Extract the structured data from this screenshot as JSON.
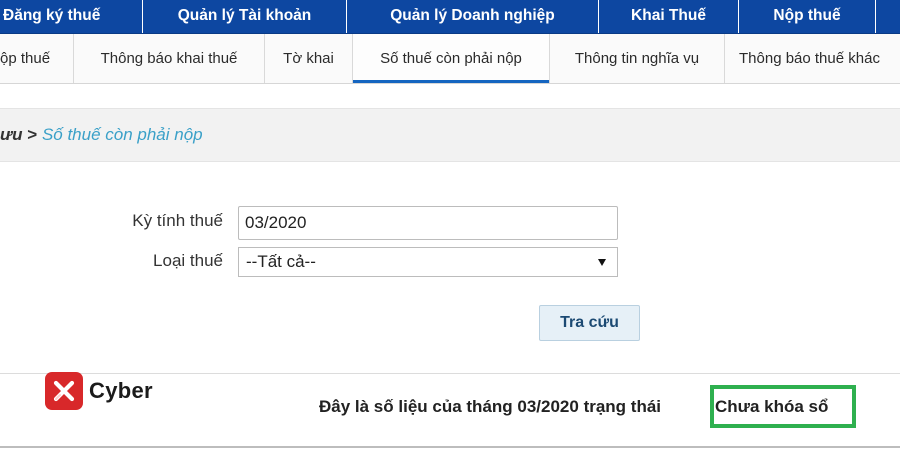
{
  "top_nav": {
    "items": [
      {
        "label": "Đăng ký thuế"
      },
      {
        "label": "Quản lý Tài khoản"
      },
      {
        "label": "Quản lý Doanh nghiệp"
      },
      {
        "label": "Khai Thuế"
      },
      {
        "label": "Nộp thuế"
      },
      {
        "label": ""
      }
    ]
  },
  "sub_nav": {
    "items": [
      {
        "label": "ộp thuế"
      },
      {
        "label": "Thông báo khai thuế"
      },
      {
        "label": "Tờ khai"
      },
      {
        "label": "Số thuế còn phải nộp",
        "active": true
      },
      {
        "label": "Thông tin nghĩa vụ"
      },
      {
        "label": "Thông báo thuế khác"
      }
    ],
    "active_color": "#1565c0"
  },
  "breadcrumb": {
    "parent": "ưu",
    "separator": ">",
    "current": "Số thuế còn phải nộp"
  },
  "form": {
    "period_label": "Kỳ tính thuế",
    "period_value": "03/2020",
    "type_label": "Loại thuế",
    "type_selected": "--Tất cả--",
    "search_label": "Tra cứu"
  },
  "result": {
    "message": "Đây là số liệu của tháng 03/2020 trạng thái",
    "status": "Chưa khóa sổ",
    "highlight_color": "#2eb04f"
  },
  "watermark": {
    "brand": "Cyber",
    "icon": "cyber-x-logo-icon"
  },
  "colors": {
    "nav_bg": "#0d47a1",
    "breadcrumb_current": "#3aa0c8",
    "button_bg": "#e6f0f7"
  }
}
